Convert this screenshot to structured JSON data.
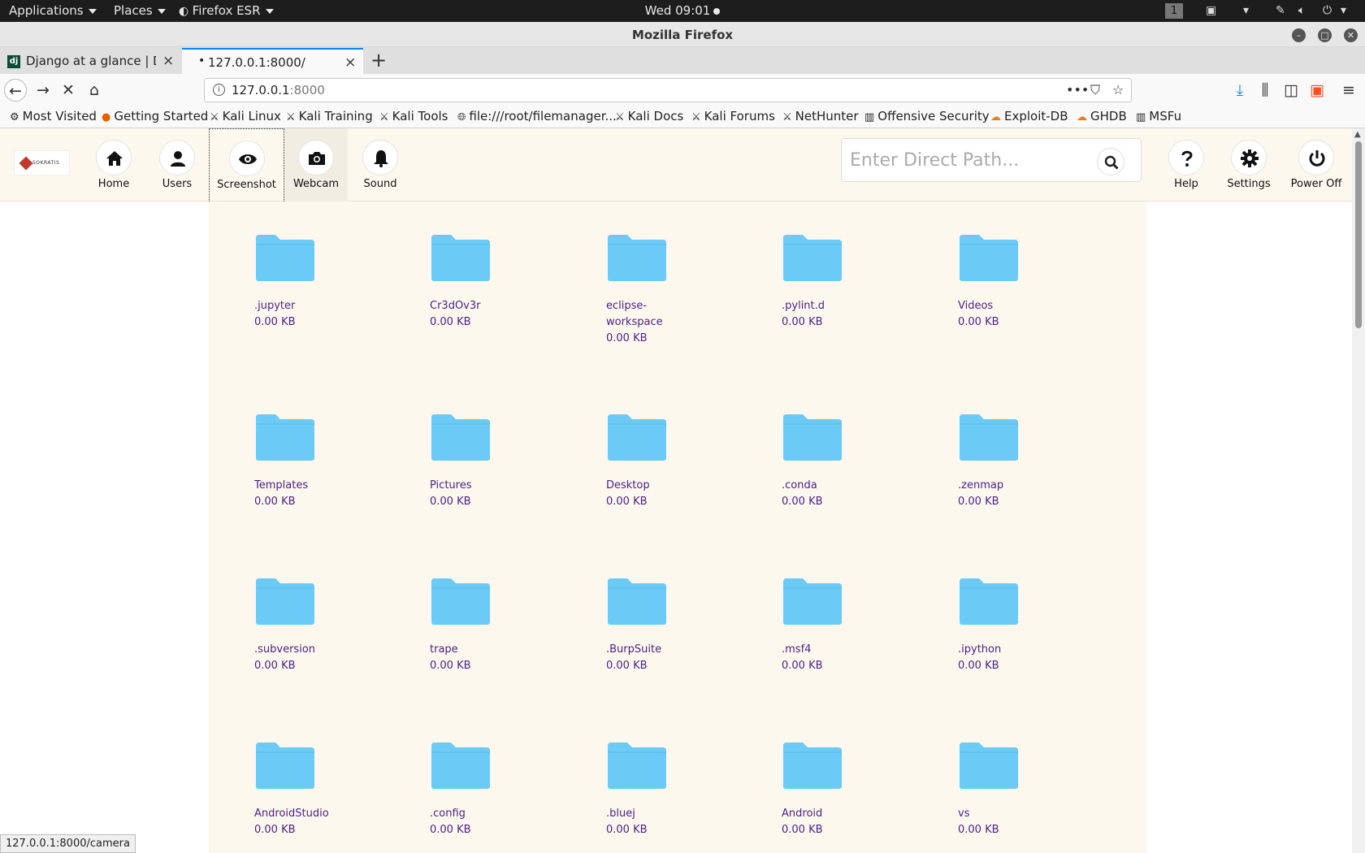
{
  "topbar": {
    "applications": "Applications",
    "places": "Places",
    "firefox": "Firefox ESR",
    "clock": "Wed 09:01",
    "workspace": "1"
  },
  "window": {
    "title": "Mozilla Firefox"
  },
  "tabs": [
    {
      "label": "Django at a glance | Djan",
      "favicon": "dj"
    },
    {
      "label": "127.0.0.1:8000/",
      "loading_dot": "•"
    }
  ],
  "urlbar": {
    "host": "127.0.0.1",
    "port": ":8000"
  },
  "bookmarks": [
    {
      "label": "Most Visited",
      "icon": "gear-icon"
    },
    {
      "label": "Getting Started",
      "icon": "firefox-icon"
    },
    {
      "label": "Kali Linux",
      "icon": "kali-icon"
    },
    {
      "label": "Kali Training",
      "icon": "kali-icon"
    },
    {
      "label": "Kali Tools",
      "icon": "kali-icon"
    },
    {
      "label": "file:///root/filemanager...",
      "icon": "globe-icon"
    },
    {
      "label": "Kali Docs",
      "icon": "kali-icon"
    },
    {
      "label": "Kali Forums",
      "icon": "kali-icon"
    },
    {
      "label": "NetHunter",
      "icon": "kali-icon"
    },
    {
      "label": "Offensive Security",
      "icon": "offsec-icon"
    },
    {
      "label": "Exploit-DB",
      "icon": "exploitdb-icon"
    },
    {
      "label": "GHDB",
      "icon": "ghdb-icon"
    },
    {
      "label": "MSFu",
      "icon": "offsec-icon"
    }
  ],
  "app": {
    "logo_text": "SOKRATIS",
    "nav": {
      "home": "Home",
      "users": "Users",
      "screenshot": "Screenshot",
      "webcam": "Webcam",
      "sound": "Sound",
      "help": "Help",
      "settings": "Settings",
      "poweroff": "Power Off"
    },
    "search_placeholder": "Enter Direct Path..."
  },
  "folders": [
    {
      "name": ".jupyter",
      "size": "0.00 KB"
    },
    {
      "name": "Cr3dOv3r",
      "size": "0.00 KB"
    },
    {
      "name": "eclipse-\nworkspace",
      "size": "0.00 KB"
    },
    {
      "name": ".pylint.d",
      "size": "0.00 KB"
    },
    {
      "name": "Videos",
      "size": "0.00 KB"
    },
    {
      "name": "Templates",
      "size": "0.00 KB"
    },
    {
      "name": "Pictures",
      "size": "0.00 KB"
    },
    {
      "name": "Desktop",
      "size": "0.00 KB"
    },
    {
      "name": ".conda",
      "size": "0.00 KB"
    },
    {
      "name": ".zenmap",
      "size": "0.00 KB"
    },
    {
      "name": ".subversion",
      "size": "0.00 KB"
    },
    {
      "name": "trape",
      "size": "0.00 KB"
    },
    {
      "name": ".BurpSuite",
      "size": "0.00 KB"
    },
    {
      "name": ".msf4",
      "size": "0.00 KB"
    },
    {
      "name": ".ipython",
      "size": "0.00 KB"
    },
    {
      "name": "AndroidStudio",
      "size": "0.00 KB"
    },
    {
      "name": ".config",
      "size": "0.00 KB"
    },
    {
      "name": ".bluej",
      "size": "0.00 KB"
    },
    {
      "name": "Android",
      "size": "0.00 KB"
    },
    {
      "name": "vs",
      "size": "0.00 KB"
    }
  ],
  "colors": {
    "folder": "#6ccaf7",
    "page_bg": "#fcf8ee",
    "link": "#4b1f8a",
    "accent": "#0a84ff"
  },
  "status_link": "127.0.0.1:8000/camera"
}
